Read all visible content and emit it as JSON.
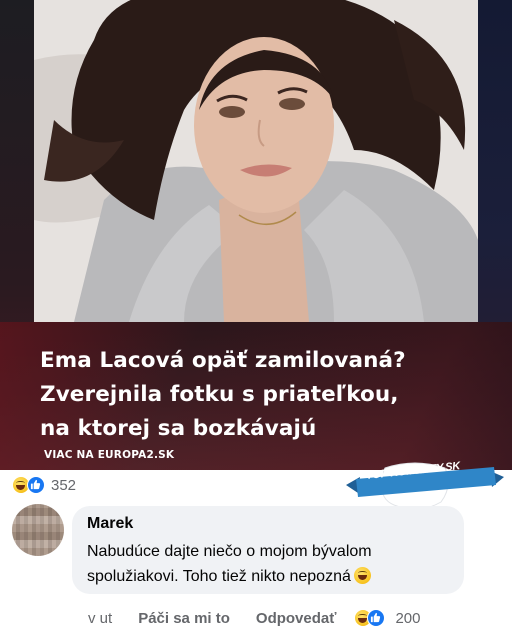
{
  "post": {
    "headline_lines": [
      "Ema Lacová opäť zamilovaná?",
      "Zverejnila fotku s priateľkou,",
      "na ktorej sa bozkávajú"
    ],
    "source_link": "VIAC NA EUROPA2.SK",
    "reaction_count": "352",
    "reaction_icons": [
      "haha-reaction-icon",
      "like-reaction-icon"
    ]
  },
  "badge": {
    "text": "TOP KOMENTY.SK",
    "color": "#2f86c8"
  },
  "comment": {
    "author": "Marek",
    "text": "Nabudúce dajte niečo o mojom bývalom spolužiakovi. Toho tiež nikto nepozná",
    "trailing_emoji": "laughing-emoji-icon",
    "time": "v ut",
    "like_label": "Páči sa mi to",
    "reply_label": "Odpovedať",
    "reaction_count": "200"
  },
  "colors": {
    "bubble_bg": "#f0f2f5",
    "meta_text": "#65676b",
    "like_blue": "#1877f2"
  }
}
